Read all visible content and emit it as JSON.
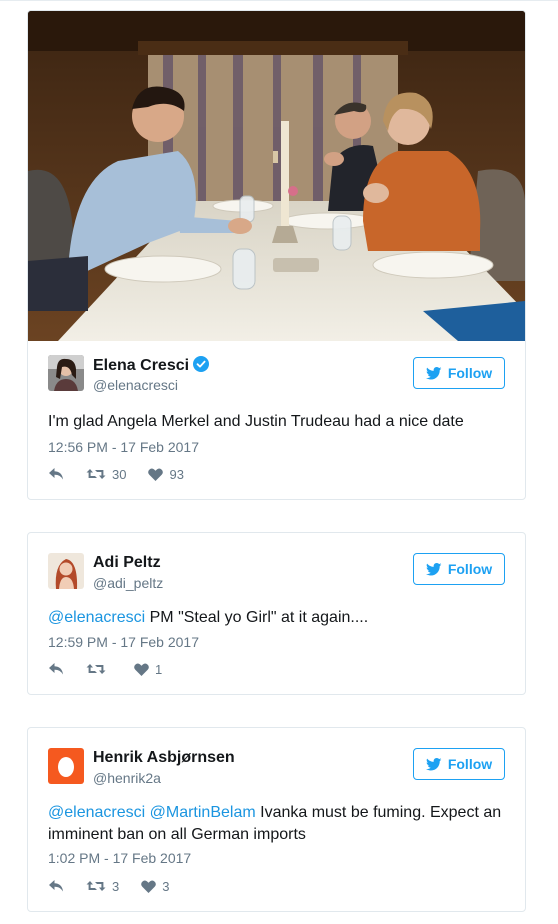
{
  "tweets": [
    {
      "name": "Elena Cresci",
      "handle": "@elenacresci",
      "verified": true,
      "follow_label": "Follow",
      "text": "I'm glad Angela Merkel and Justin Trudeau had a nice date",
      "timestamp": "12:56 PM - 17 Feb 2017",
      "retweets": "30",
      "likes": "93",
      "has_photo": true
    },
    {
      "name": "Adi Peltz",
      "handle": "@adi_peltz",
      "follow_label": "Follow",
      "mention1": "@elenacresci",
      "text": " PM \"Steal yo Girl\" at it again....",
      "timestamp": "12:59 PM - 17 Feb 2017",
      "retweets": "",
      "likes": "1"
    },
    {
      "name": "Henrik Asbjørnsen",
      "handle": "@henrik2a",
      "follow_label": "Follow",
      "mention1": "@elenacresci",
      "mention2": "@MartinBelam",
      "text": " Ivanka must be fuming. Expect an imminent ban on all German imports",
      "timestamp": "1:02 PM - 17 Feb 2017",
      "retweets": "3",
      "likes": "3"
    }
  ],
  "colors": {
    "accent": "#1da1f2",
    "link": "#1b95e0",
    "muted": "#657786",
    "border": "#e1e8ed"
  },
  "icons": [
    "reply-icon",
    "retweet-icon",
    "heart-icon",
    "twitter-bird-icon",
    "verified-badge-icon",
    "egg-avatar-icon"
  ]
}
